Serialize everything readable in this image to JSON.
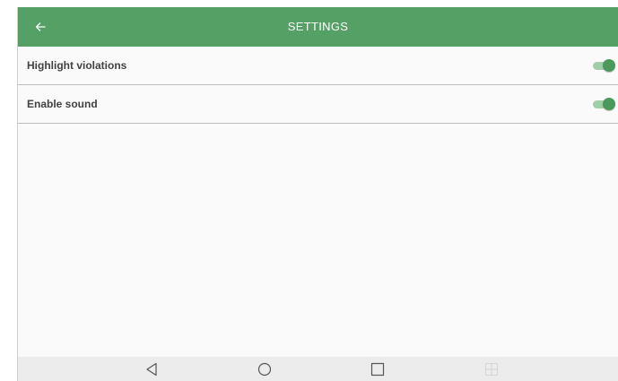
{
  "app_bar": {
    "title": "SETTINGS",
    "back_icon": "arrow-back-icon",
    "background_color": "#55a064"
  },
  "settings": [
    {
      "label": "Highlight violations",
      "enabled": true
    },
    {
      "label": "Enable sound",
      "enabled": true
    }
  ],
  "nav_bar": {
    "buttons": [
      "back-triangle-icon",
      "home-circle-icon",
      "recents-square-icon",
      "split-screen-icon"
    ]
  },
  "colors": {
    "accent": "#55a064",
    "switch_thumb": "#4b9a5b",
    "switch_track": "#9fcfa8"
  }
}
